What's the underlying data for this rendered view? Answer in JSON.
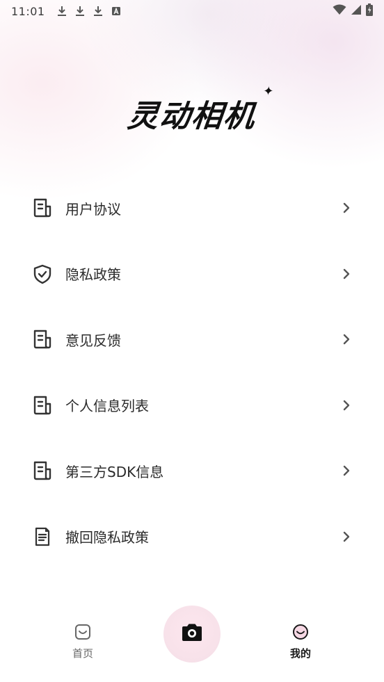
{
  "status_bar": {
    "time": "11:01",
    "left_icons": [
      "download-icon",
      "download-icon",
      "download-icon",
      "a-icon"
    ],
    "right_icons": [
      "wifi-icon",
      "signal-icon",
      "battery-icon"
    ]
  },
  "app": {
    "logo_text": "灵动相机"
  },
  "menu": {
    "items": [
      {
        "label": "用户协议",
        "icon": "document-icon"
      },
      {
        "label": "隐私政策",
        "icon": "shield-check-icon"
      },
      {
        "label": "意见反馈",
        "icon": "document-icon"
      },
      {
        "label": "个人信息列表",
        "icon": "document-icon"
      },
      {
        "label": "第三方SDK信息",
        "icon": "document-icon"
      },
      {
        "label": "撤回隐私政策",
        "icon": "clipboard-doc-icon"
      }
    ]
  },
  "tab_bar": {
    "home_label": "首页",
    "mine_label": "我的",
    "active": "mine",
    "camera_icon": "camera-icon"
  },
  "colors": {
    "text_primary": "#2b2b2b",
    "icon": "#333333",
    "tab_active": "#1a1a1a",
    "tab_inactive": "#666666",
    "camera_bg": "#f8e2ea"
  }
}
